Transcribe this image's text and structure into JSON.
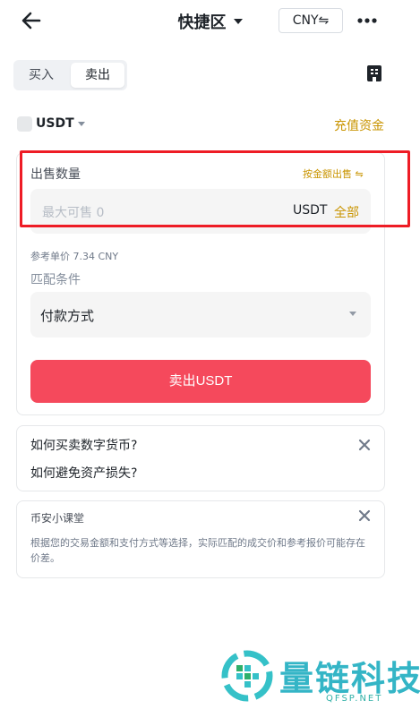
{
  "header": {
    "title": "快捷区",
    "currency": "CNY⇋"
  },
  "trade_tabs": {
    "buy": "买入",
    "sell": "卖出",
    "selected": "sell"
  },
  "coin": {
    "name": "USDT",
    "deposit_link": "充值资金"
  },
  "sell_form": {
    "amount_label": "出售数量",
    "switch_mode": "按金额出售 ⇋",
    "placeholder": "最大可售 0",
    "unit": "USDT",
    "all_button": "全部",
    "reference_price": "参考单价 7.34 CNY",
    "match_label": "匹配条件",
    "payment_method": "付款方式",
    "submit": "卖出USDT"
  },
  "faq": {
    "items": [
      "如何买卖数字货币?",
      "如何避免资产损失?"
    ]
  },
  "tip": {
    "title": "币安小课堂",
    "body": "根据您的交易金额和支付方式等选择，实际匹配的成交价和参考报价可能存在价差。"
  },
  "watermark": {
    "name": "量链科技",
    "domain": "QFSP.NET"
  },
  "colors": {
    "accent": "#c99400",
    "sell": "#f5495c",
    "highlight": "#ee1c25",
    "watermark": "#34b5c6"
  }
}
